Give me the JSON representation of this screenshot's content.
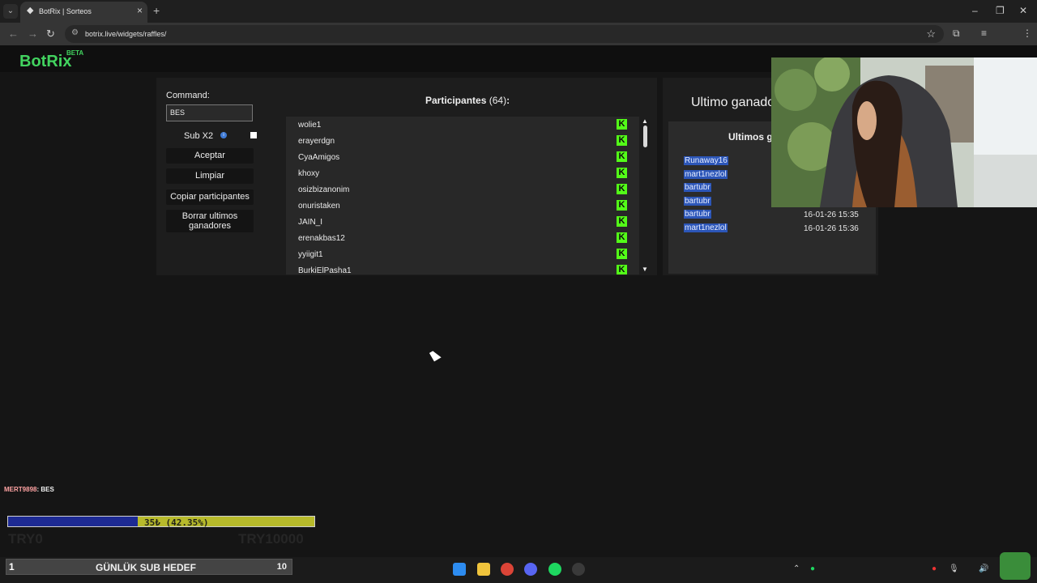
{
  "browser": {
    "tab_title": "BotRix | Sorteos",
    "url": "botrix.live/widgets/raffles/"
  },
  "app": {
    "logo": "BotRix",
    "badge": "BETA"
  },
  "controls": {
    "command_label": "Command:",
    "command_value": "BES",
    "sub_x2_label": "Sub X2",
    "sub_x2_checked": false,
    "accept_label": "Aceptar",
    "clear_label": "Limpiar",
    "copy_label": "Copiar participantes",
    "delete_winners_label": "Borrar ultimos ganadores"
  },
  "participants": {
    "title_prefix": "Participantes",
    "count": "(64)",
    "title_suffix": ":",
    "items": [
      "wolie1",
      "erayerdgn",
      "CyaAmigos",
      "khoxy",
      "osizbizanonim",
      "onuristaken",
      "JAIN_I",
      "erenakbas12",
      "yyiigit1",
      "BurkiElPasha1"
    ]
  },
  "winners": {
    "last_winner_label": "Ultimo ganador",
    "recent_title": "Ultimos ganadores",
    "items": [
      {
        "name": "Runaway16",
        "date": ""
      },
      {
        "name": "mart1nezlol",
        "date": ""
      },
      {
        "name": "bartubr",
        "date": ""
      },
      {
        "name": "bartubr",
        "date": ""
      },
      {
        "name": "bartubr",
        "date": "16-01-26 15:35"
      },
      {
        "name": "mart1nezlol",
        "date": "16-01-26 15:36"
      }
    ]
  },
  "overlay": {
    "chat_user": "MERT9898",
    "chat_message": ": BES",
    "goal_text": "35₺ (42.35%)",
    "goal_progress": 0.4235,
    "goal_min": "TRY0",
    "goal_max": "TRY10000",
    "sub_goal_count": "1",
    "sub_goal_label": "GÜNLÜK SUB HEDEF",
    "sub_goal_target": "10"
  },
  "colors": {
    "brand": "#42d35f",
    "kick": "#53fc18",
    "highlight": "#2c56b8"
  }
}
